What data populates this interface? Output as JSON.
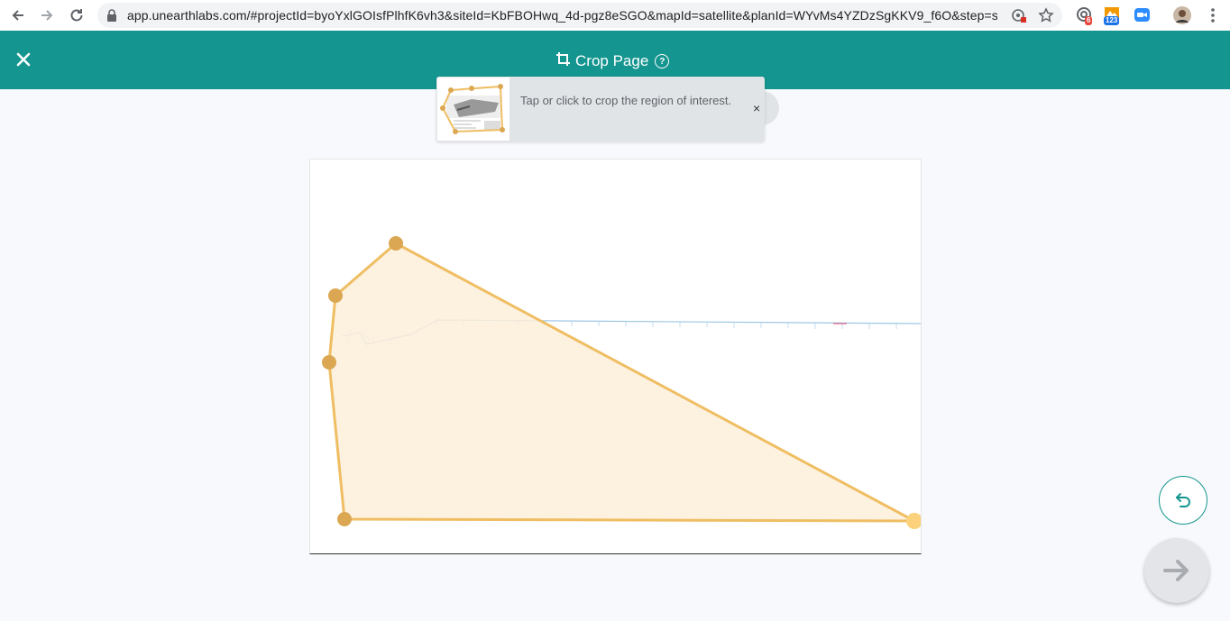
{
  "browser": {
    "url": "app.unearthlabs.com/#projectId=byoYxlGOIsfPlhfK6vh3&siteId=KbFBOHwq_4d-pgz8eSGO&mapId=satellite&planId=WYvMs4YZDzSgKKV9_f6O&step=sta...",
    "ext_badge_1": "6",
    "ext_badge_2": "123"
  },
  "header": {
    "title": "Crop Page",
    "help_glyph": "?"
  },
  "tooltip": {
    "text": "Tap or click to crop the region of interest.",
    "close_glyph": "×"
  },
  "colors": {
    "header_bg": "#14958f",
    "crop_fill": "#fdeedb",
    "crop_stroke": "#efbe63",
    "handle": "#dba752",
    "handle_last": "#fcd17c"
  }
}
